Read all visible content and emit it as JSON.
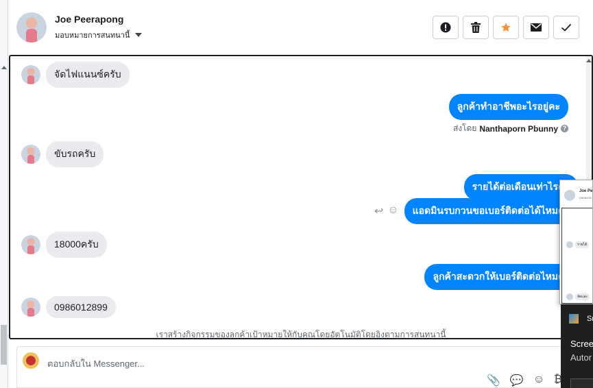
{
  "header": {
    "contact_name": "Joe Peerapong",
    "assign_label": "มอบหมายการสนทนานี้",
    "actions": [
      {
        "name": "spam-button",
        "icon": "exclamation-circle-icon"
      },
      {
        "name": "delete-button",
        "icon": "trash-icon"
      },
      {
        "name": "star-button",
        "icon": "star-icon",
        "color": "#f7923b"
      },
      {
        "name": "mark-unread-button",
        "icon": "envelope-icon"
      },
      {
        "name": "done-button",
        "icon": "checkmark-icon"
      }
    ]
  },
  "messages": [
    {
      "direction": "in",
      "text": "จัดไฟแนนซ์ครับ"
    },
    {
      "direction": "out",
      "text": "ลูกค้าทำอาชีพอะไรอยู่คะ"
    },
    {
      "direction": "in",
      "text": "ขับรถครับ"
    },
    {
      "direction": "out",
      "text": "รายได้ต่อเดือนเท่าไรคะ"
    },
    {
      "direction": "out",
      "text": "แอดมินรบกวนขอเบอร์ติดต่อได้ไหมคะ"
    },
    {
      "direction": "in",
      "text": "18000ครับ"
    },
    {
      "direction": "out",
      "text": "ลูกค้าสะดวกให้เบอร์ติดต่อไหมคะ"
    },
    {
      "direction": "in",
      "text": "0986012899"
    }
  ],
  "sent_by": {
    "prefix": "ส่งโดย",
    "agent": "Nanthaporn Pbunny",
    "help": "?"
  },
  "footer_note": "เราสร้างกิจกรรมของลูกค้าเป้าหมายให้กับคุณโดยอัตโนมัติโดยอิงตามการสนทนานี้",
  "reply": {
    "placeholder": "ตอบกลับใน Messenger..."
  },
  "popup": {
    "name": "Joe Pe",
    "subtitle": "มอบหมาย",
    "row1": "รายได้",
    "row2": "จัดและ"
  },
  "toast": {
    "app": "Sn",
    "title": "Scree",
    "body": "Autor"
  },
  "colors": {
    "outgoing_bubble": "#0084ff",
    "incoming_bubble": "#e9ebee",
    "star": "#f7923b"
  }
}
